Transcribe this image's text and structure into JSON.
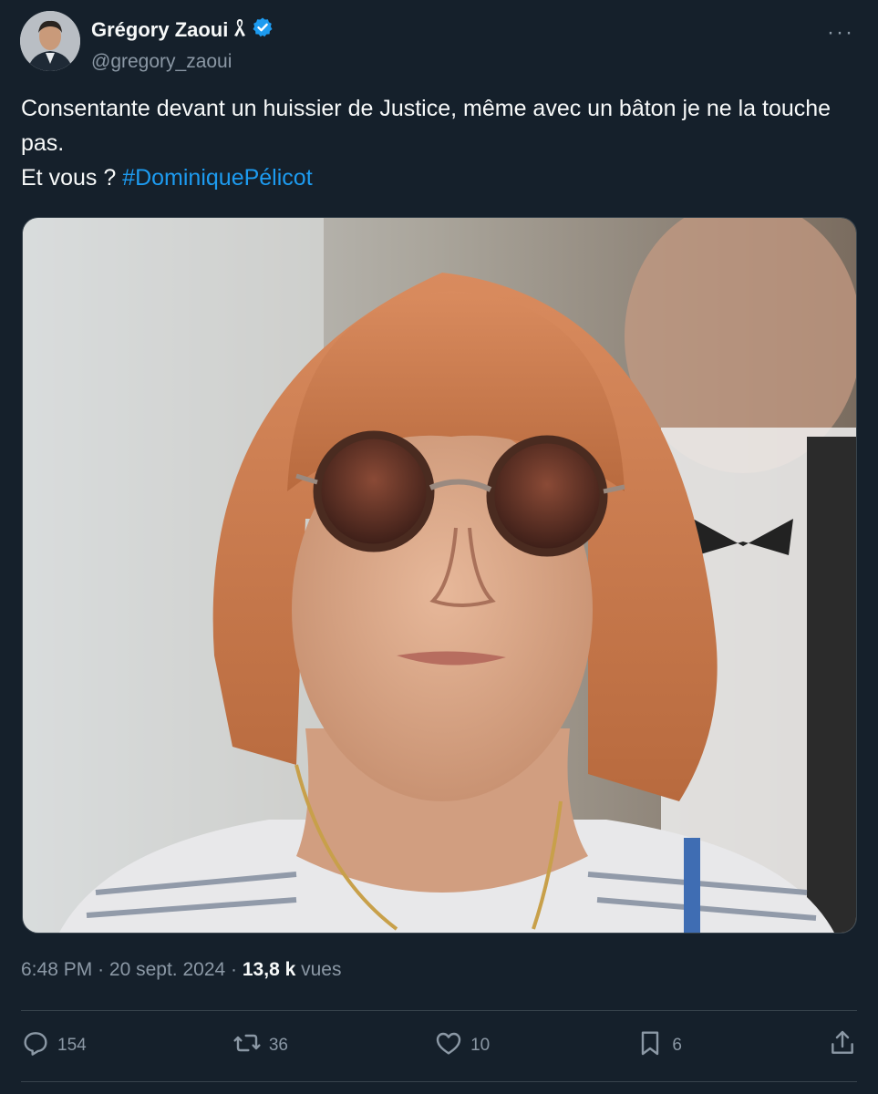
{
  "author": {
    "display_name": "Grégory Zaoui",
    "handle": "@gregory_zaoui",
    "ribbon_icon": "ribbon-icon",
    "verified_icon": "verified-badge-icon",
    "verified_color": "#1d9bf0"
  },
  "menu": {
    "more_label": "···"
  },
  "tweet": {
    "line1": "Consentante devant un huissier de Justice, même avec un bâton je ne la touche pas.",
    "line2_prefix": "Et vous ?",
    "hashtag": "#DominiquePélicot"
  },
  "meta": {
    "time": "6:48 PM",
    "date": "20 sept. 2024",
    "views_count": "13,8 k",
    "views_label": "vues"
  },
  "actions": {
    "reply_count": "154",
    "retweet_count": "36",
    "like_count": "10",
    "bookmark_count": "6"
  },
  "colors": {
    "background": "#15202b",
    "muted": "#8b98a5",
    "link": "#1d9bf0",
    "divider": "#38444d"
  }
}
